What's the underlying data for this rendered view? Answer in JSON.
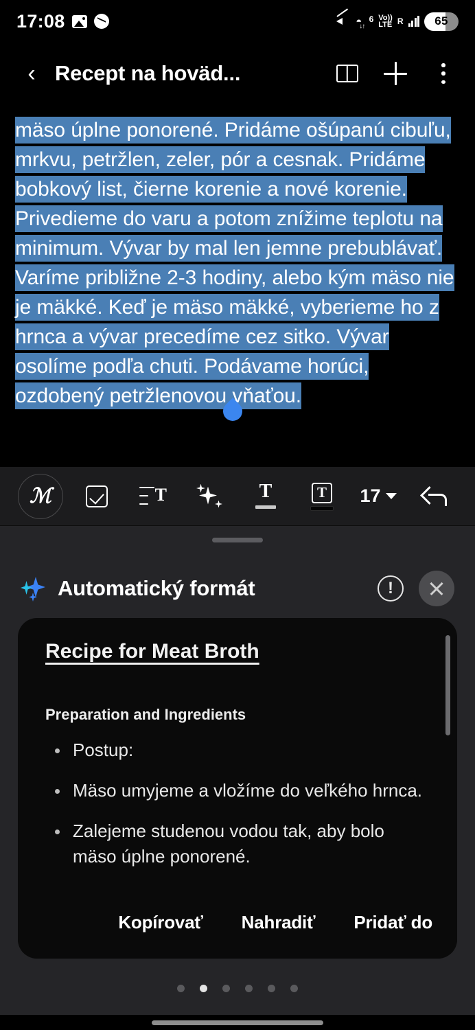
{
  "status_bar": {
    "time": "17:08",
    "left_icons": [
      "image-icon",
      "messenger-icon"
    ],
    "right_icons": [
      "mute-icon",
      "wifi-6-icon",
      "volte-icon",
      "roaming-signal-icon"
    ],
    "wifi_generation": "6",
    "volte_line1": "Vo))",
    "volte_line2": "LTE",
    "roaming_label": "R",
    "battery_level": "65"
  },
  "app_bar": {
    "back_icon": "chevron-left-icon",
    "title": "Recept na hoväd...",
    "actions": [
      {
        "icon": "book-icon",
        "name": "reading-mode-button"
      },
      {
        "icon": "plus-icon",
        "name": "add-button"
      },
      {
        "icon": "more-vert-icon",
        "name": "overflow-menu-button"
      }
    ]
  },
  "note": {
    "selected_text": "mäso úplne ponorené. Pridáme ošúpanú cibuľu, mrkvu, petržlen, zeler, pór a cesnak. Pridáme bobkový list, čierne korenie a nové korenie. Privedieme do varu a potom znížime teplotu na minimum. Vývar by mal len jemne prebublávať. Varíme približne 2-3 hodiny, alebo kým mäso nie je mäkké. Keď je mäso mäkké, vyberieme ho z hrnca a vývar precedíme cez sitko. Vývar osolíme podľa chuti. Podávame horúci, ozdobený petržlenovou vňaťou.",
    "selection_color": "#4a7fb5",
    "handle_color": "#3b86ef"
  },
  "toolbar": {
    "items": [
      {
        "name": "handwriting-button",
        "icon": "pen-scribble-icon",
        "label": "ℳ"
      },
      {
        "name": "checklist-button",
        "icon": "checkbox-icon",
        "label": ""
      },
      {
        "name": "paragraph-style-button",
        "icon": "paragraph-text-icon",
        "label": "T"
      },
      {
        "name": "ai-assist-button",
        "icon": "sparkles-icon",
        "label": ""
      },
      {
        "name": "text-color-button",
        "icon": "text-color-icon",
        "label": "T"
      },
      {
        "name": "highlight-button",
        "icon": "text-highlight-icon",
        "label": "T"
      },
      {
        "name": "font-size-button",
        "icon": "chevron-down-icon",
        "label": "17"
      },
      {
        "name": "undo-button",
        "icon": "undo-arrow-icon",
        "label": ""
      }
    ],
    "font_size": "17"
  },
  "sheet": {
    "title": "Automatický formát",
    "leading_icon": "sparkles-icon",
    "info_icon": "info-circle-icon",
    "close_icon": "close-icon",
    "card": {
      "heading": "Recipe for Meat Broth",
      "subheading": "Preparation and Ingredients",
      "bullets": [
        "Postup:",
        "Mäso umyjeme a vložíme do veľkého hrnca.",
        "Zalejeme studenou vodou tak, aby bolo mäso úplne ponorené."
      ]
    },
    "actions": [
      {
        "name": "copy-button",
        "label": "Kopírovať"
      },
      {
        "name": "replace-button",
        "label": "Nahradiť"
      },
      {
        "name": "add-to-button",
        "label": "Pridať do"
      }
    ],
    "pager": {
      "count": 6,
      "active_index": 1
    }
  }
}
